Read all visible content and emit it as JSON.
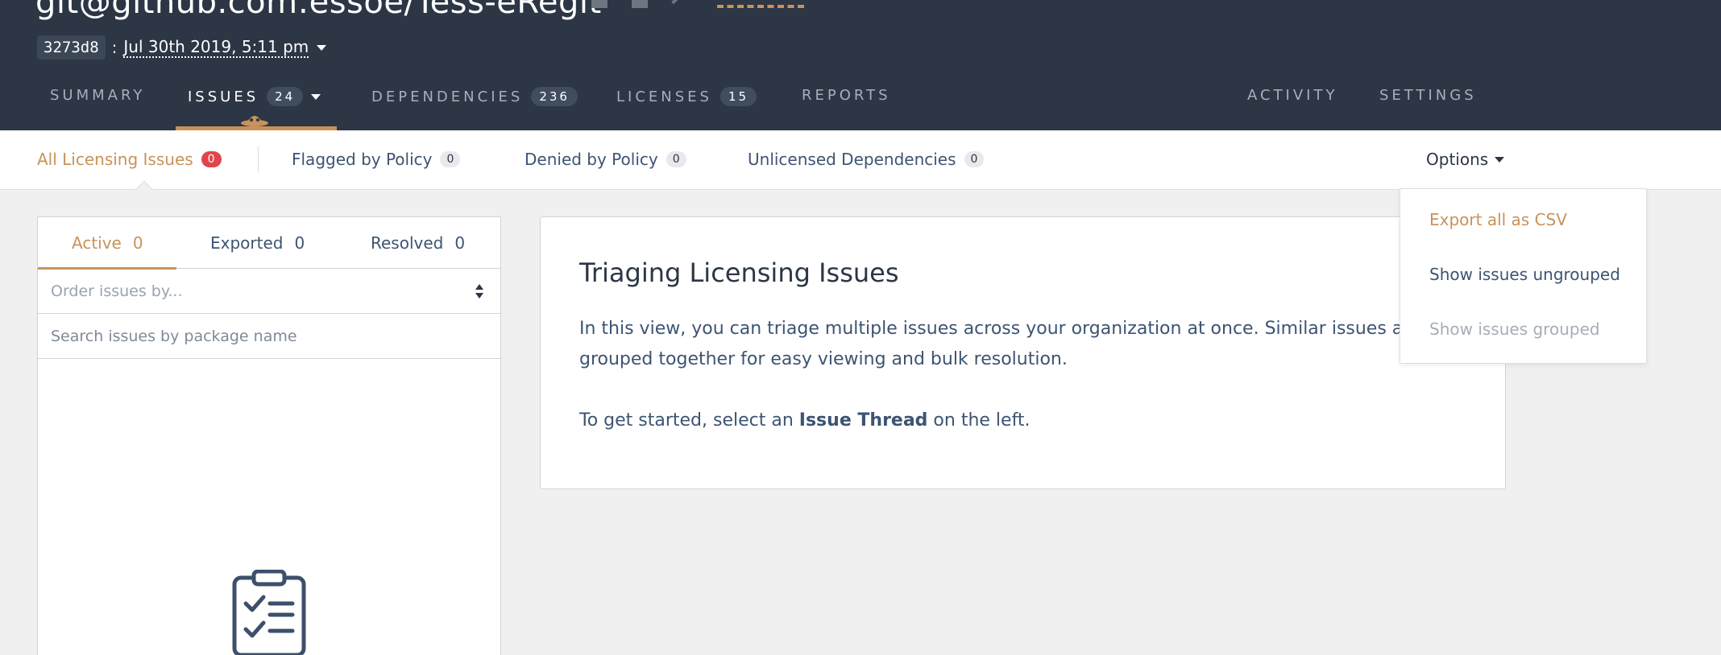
{
  "header": {
    "repo_title": "git@github.com:essoe/Tess-eRegit",
    "commit_hash": "3273d8",
    "commit_separator": ":",
    "commit_date": "Jul 30th 2019, 5:11 pm"
  },
  "nav": {
    "tabs": [
      {
        "label": "SUMMARY",
        "count": null
      },
      {
        "label": "ISSUES",
        "count": "24"
      },
      {
        "label": "DEPENDENCIES",
        "count": "236"
      },
      {
        "label": "LICENSES",
        "count": "15"
      },
      {
        "label": "REPORTS",
        "count": null
      }
    ],
    "right_tabs": [
      {
        "label": "ACTIVITY"
      },
      {
        "label": "SETTINGS"
      }
    ],
    "active": "ISSUES"
  },
  "subnav": {
    "tabs": [
      {
        "label": "All Licensing Issues",
        "count": "0"
      },
      {
        "label": "Flagged by Policy",
        "count": "0"
      },
      {
        "label": "Denied by Policy",
        "count": "0"
      },
      {
        "label": "Unlicensed Dependencies",
        "count": "0"
      }
    ],
    "options_label": "Options"
  },
  "left_panel": {
    "tabs": [
      {
        "label": "Active",
        "count": "0"
      },
      {
        "label": "Exported",
        "count": "0"
      },
      {
        "label": "Resolved",
        "count": "0"
      }
    ],
    "order_placeholder": "Order issues by...",
    "search_placeholder": "Search issues by package name"
  },
  "main_card": {
    "title": "Triaging Licensing Issues",
    "paragraph1": "In this view, you can triage multiple issues across your organization at once. Similar issues are grouped together for easy viewing and bulk resolution.",
    "paragraph2_prefix": "To get started, select an ",
    "paragraph2_bold": "Issue Thread",
    "paragraph2_suffix": " on the left."
  },
  "options_menu": {
    "items": [
      {
        "label": "Export all as CSV"
      },
      {
        "label": "Show issues ungrouped"
      },
      {
        "label": "Show issues grouped"
      }
    ]
  },
  "colors": {
    "header_bg": "#2c3645",
    "accent": "#c9925a",
    "badge_red": "#e0454a"
  }
}
